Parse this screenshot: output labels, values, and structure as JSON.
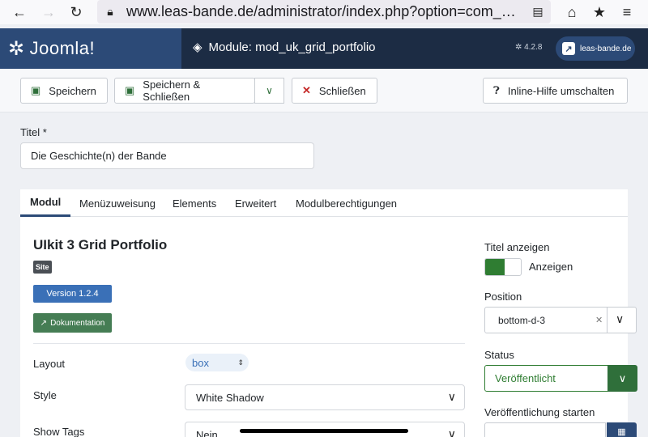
{
  "browser": {
    "url": "www.leas-bande.de/administrator/index.php?option=com_modules&view=module&layout=edit"
  },
  "header": {
    "logo_text": "Joomla!",
    "page_title": "Module: mod_uk_grid_portfolio",
    "version": "4.2.8",
    "site_link": "leas-bande.de"
  },
  "toolbar": {
    "save_label": "Speichern",
    "save_close_label": "Speichern & Schließen",
    "close_label": "Schließen",
    "help_label": "Inline-Hilfe umschalten"
  },
  "form": {
    "title_label": "Titel *",
    "title_value": "Die Geschichte(n) der Bande"
  },
  "tabs": [
    {
      "label": "Modul",
      "active": true
    },
    {
      "label": "Menüzuweisung",
      "active": false
    },
    {
      "label": "Elements",
      "active": false
    },
    {
      "label": "Erweitert",
      "active": false
    },
    {
      "label": "Modulberechtigungen",
      "active": false
    }
  ],
  "module": {
    "name": "UIkit 3 Grid Portfolio",
    "site_badge": "Site",
    "version_badge": "Version 1.2.4",
    "doc_badge": "Dokumentation"
  },
  "fields": {
    "layout_label": "Layout",
    "layout_value": "box",
    "style_label": "Style",
    "style_value": "White Shadow",
    "tags_label": "Show Tags",
    "tags_value": "Nein"
  },
  "sidebar": {
    "show_title_label": "Titel anzeigen",
    "show_title_value": "Anzeigen",
    "position_label": "Position",
    "position_value": "bottom-d-3",
    "status_label": "Status",
    "status_value": "Veröffentlicht",
    "publish_start_label": "Veröffentlichung starten"
  },
  "colors": {
    "header_dark": "#1c2c44",
    "header_logo": "#2c4a77",
    "success": "#2f6f3a",
    "danger": "#c52827",
    "primary": "#3a70b7"
  }
}
